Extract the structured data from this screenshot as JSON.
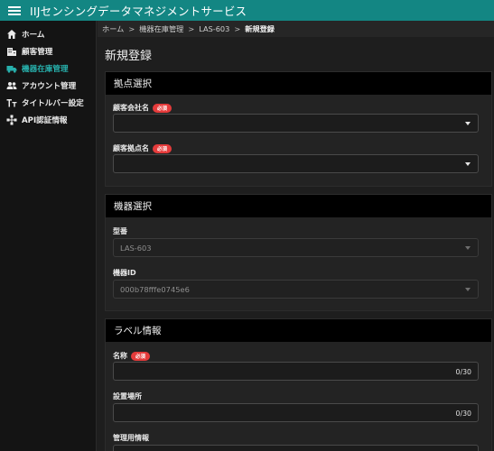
{
  "app": {
    "title": "IIJセンシングデータマネジメントサービス"
  },
  "sidebar": {
    "items": [
      {
        "label": "ホーム",
        "icon": "home-icon"
      },
      {
        "label": "顧客管理",
        "icon": "building-icon"
      },
      {
        "label": "機器在庫管理",
        "icon": "truck-icon",
        "active": true
      },
      {
        "label": "アカウント管理",
        "icon": "people-icon"
      },
      {
        "label": "タイトルバー設定",
        "icon": "text-format-icon"
      },
      {
        "label": "API認証情報",
        "icon": "network-icon"
      }
    ]
  },
  "breadcrumb": {
    "home": "ホーム",
    "inventory": "機器在庫管理",
    "model": "LAS-603",
    "current": "新規登録"
  },
  "page": {
    "title": "新規登録"
  },
  "sections": {
    "location": {
      "header": "拠点選択",
      "company_label": "顧客会社名",
      "site_label": "顧客拠点名",
      "required_badge": "必須"
    },
    "device": {
      "header": "機器選択",
      "model_label": "型番",
      "model_value": "LAS-603",
      "device_id_label": "機器ID",
      "device_id_value": "000b78fffe0745e6"
    },
    "label_info": {
      "header": "ラベル情報",
      "name_label": "名称",
      "name_counter": "0/30",
      "place_label": "設置場所",
      "place_counter": "0/30",
      "mgmt_label": "管理用情報",
      "required_badge": "必須"
    }
  },
  "colors": {
    "topbar": "#138683",
    "accent": "#27b0ac",
    "required": "#e53b3b"
  }
}
